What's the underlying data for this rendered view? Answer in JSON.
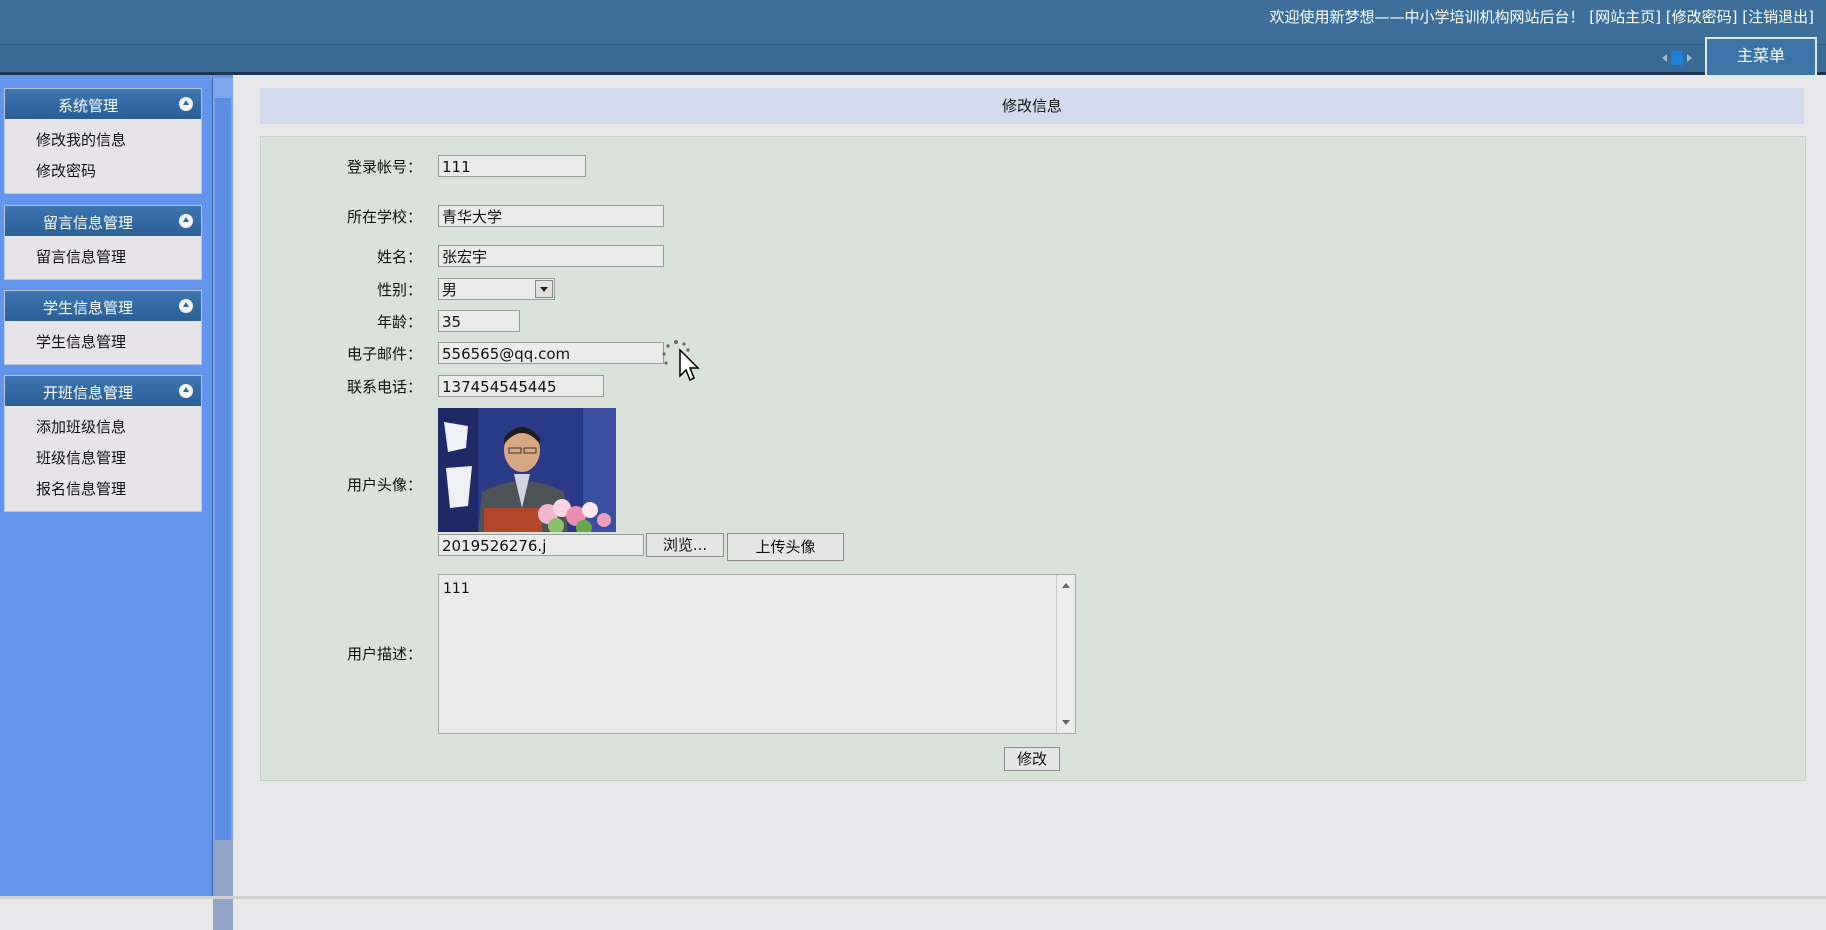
{
  "header": {
    "welcome": "欢迎使用新梦想——中小学培训机构网站后台！",
    "links": [
      "[网站主页]",
      "[修改密码]",
      "[注销退出]"
    ],
    "main_menu_tab": "主菜单"
  },
  "sidebar": {
    "groups": [
      {
        "title": "系统管理",
        "items": [
          "修改我的信息",
          "修改密码"
        ]
      },
      {
        "title": "留言信息管理",
        "items": [
          "留言信息管理"
        ]
      },
      {
        "title": "学生信息管理",
        "items": [
          "学生信息管理"
        ]
      },
      {
        "title": "开班信息管理",
        "items": [
          "添加班级信息",
          "班级信息管理",
          "报名信息管理"
        ]
      }
    ]
  },
  "panel": {
    "title": "修改信息"
  },
  "form": {
    "account_label": "登录帐号：",
    "account_value": "111",
    "school_label": "所在学校：",
    "school_value": "青华大学",
    "name_label": "姓名：",
    "name_value": "张宏宇",
    "gender_label": "性别：",
    "gender_value": "男",
    "age_label": "年龄：",
    "age_value": "35",
    "email_label": "电子邮件：",
    "email_value": "556565@qq.com",
    "phone_label": "联系电话：",
    "phone_value": "137454545445",
    "avatar_label": "用户头像：",
    "file_value": "2019526276.j",
    "browse_button": "浏览...",
    "upload_button": "上传头像",
    "desc_label": "用户描述：",
    "desc_value": "111",
    "submit_button": "修改"
  },
  "colors": {
    "topbar": "#3d6f9a",
    "sidebar": "#6495ed",
    "form_bg": "#d9e3da",
    "panel_title_bg": "#d3dbef"
  }
}
